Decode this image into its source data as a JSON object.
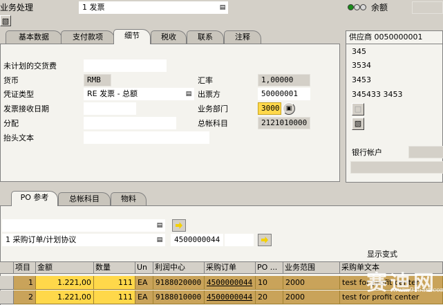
{
  "header": {
    "title_fragment": "业务处理",
    "transaction_value": "1 发票",
    "balance_label": "余额",
    "status_colors": [
      "#1a8a1a",
      "#d8d8d8",
      "#d8d8d8"
    ]
  },
  "tabs": [
    "基本数据",
    "支付款项",
    "细节",
    "税收",
    "联系",
    "注释"
  ],
  "active_tab": "细节",
  "detail": {
    "unplanned_label": "未计划的交货费",
    "unplanned_value": "",
    "currency_label": "货币",
    "currency_value": "RMB",
    "exchange_label": "汇率",
    "exchange_value": "1,00000",
    "doctype_label": "凭证类型",
    "doctype_value": "RE 发票 - 总额",
    "invoicing_party_label": "出票方",
    "invoicing_party_value": "50000001",
    "receipt_date_label": "发票接收日期",
    "receipt_date_value": "",
    "business_area_label": "业务部门",
    "business_area_value": "3000",
    "allocation_label": "分配",
    "allocation_value": "",
    "gl_label": "总帐科目",
    "gl_value": "2121010000",
    "header_text_label": "抬头文本",
    "header_text_value": ""
  },
  "vendor": {
    "title": "供应商 0050000001",
    "lines": [
      "345",
      "3534",
      "3453",
      "345433 3453"
    ],
    "bank_label": "银行帐户"
  },
  "lower_tabs": [
    "PO 参考",
    "总帐科目",
    "物料"
  ],
  "lower_active_tab": "PO 参考",
  "po_ref": {
    "ref_type_value": "1 采购订单/计划协议",
    "po_number_value": "4500000044",
    "display_variant_label": "显示变式"
  },
  "grid": {
    "columns": [
      "项目",
      "金额",
      "数量",
      "Un",
      "利润中心",
      "采购订单",
      "PO ...",
      "业务范围",
      "采购单文本"
    ],
    "rows": [
      [
        "1",
        "1.221,00",
        "111",
        "EA",
        "9188020000",
        "4500000044",
        "10",
        "2000",
        "test for profit center"
      ],
      [
        "2",
        "1.221,00",
        "111",
        "EA",
        "9188010000",
        "4500000044",
        "20",
        "2000",
        "test for profit center"
      ]
    ]
  },
  "watermark": {
    "main": "赛迪网",
    "url": "www.915art.com"
  }
}
